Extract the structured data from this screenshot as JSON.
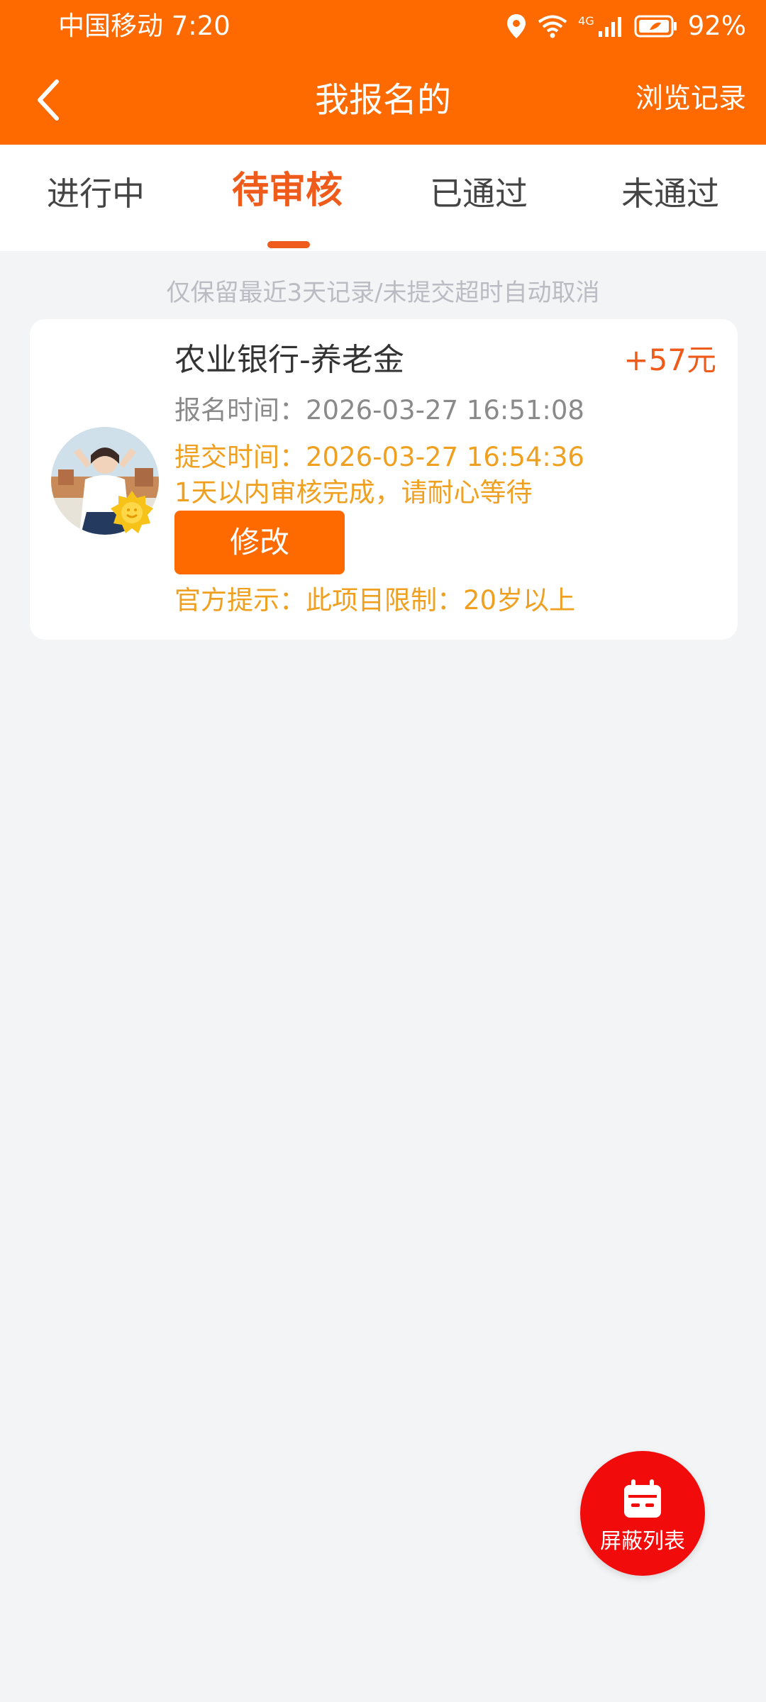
{
  "status_bar": {
    "carrier_time": "中国移动 7:20",
    "network": "4G",
    "battery": "92%",
    "icons": [
      "location-icon",
      "wifi-icon",
      "signal-icon",
      "battery-icon"
    ]
  },
  "header": {
    "title": "我报名的",
    "right_link": "浏览记录",
    "back_icon": "back-arrow-icon"
  },
  "tabs": [
    {
      "label": "进行中",
      "active": false
    },
    {
      "label": "待审核",
      "active": true
    },
    {
      "label": "已通过",
      "active": false
    },
    {
      "label": "未通过",
      "active": false
    }
  ],
  "hint": "仅保留最近3天记录/未提交超时自动取消",
  "task": {
    "title": "农业银行-养老金",
    "reward": "+57元",
    "register_time": "报名时间：2026-03-27 16:51:08",
    "submit_time": "提交时间：2026-03-27 16:54:36",
    "review_note": "1天以内审核完成，请耐心等待",
    "modify_label": "修改",
    "official_tip": "官方提示：此项目限制：20岁以上"
  },
  "fab": {
    "label": "屏蔽列表",
    "icon": "calendar-icon"
  },
  "colors": {
    "header_bg": "#ff6a00",
    "accent": "#ef5b1b",
    "warning_text": "#f0a020",
    "fab_bg": "#f10b0b"
  }
}
